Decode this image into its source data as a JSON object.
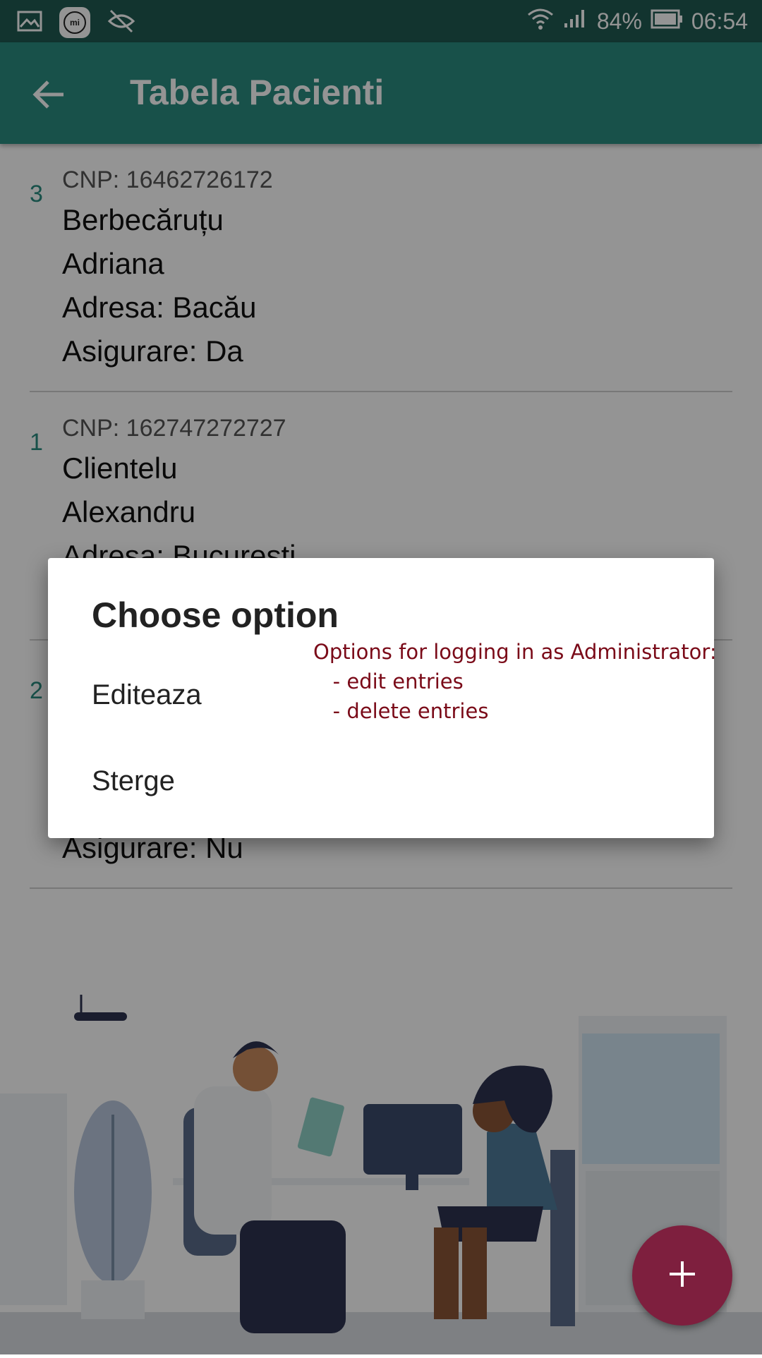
{
  "status_bar": {
    "battery": "84%",
    "time": "06:54",
    "icons": [
      "gallery-icon",
      "mi-icon",
      "eye-off-icon",
      "wifi-icon",
      "signal-icon",
      "battery-icon"
    ]
  },
  "app_bar": {
    "title": "Tabela Pacienti",
    "back_icon": "arrow-left-icon"
  },
  "patients": [
    {
      "index": "3",
      "cnp": "CNP: 16462726172",
      "last_name": "Berbecăruțu",
      "first_name": "Adriana",
      "address": "Adresa: Bacău",
      "insurance": "Asigurare: Da"
    },
    {
      "index": "1",
      "cnp": "CNP: 162747272727",
      "last_name": "Clientelu",
      "first_name": "Alexandru",
      "address": "Adresa: Bucuresti",
      "insurance": ""
    },
    {
      "index": "2",
      "cnp": "",
      "last_name": "",
      "first_name": "",
      "address": "",
      "insurance": "Asigurare: Nu"
    }
  ],
  "dialog": {
    "title": "Choose option",
    "options": [
      "Editeaza",
      "Sterge"
    ],
    "annotation": "Options for logging in as Administrator:\n   - edit entries\n   - delete entries"
  },
  "fab": {
    "icon": "plus-icon"
  },
  "colors": {
    "primary": "#2a8c80",
    "status_bar": "#1f5a52",
    "fab": "#7e1f3e",
    "annotation": "#7a0a18"
  }
}
